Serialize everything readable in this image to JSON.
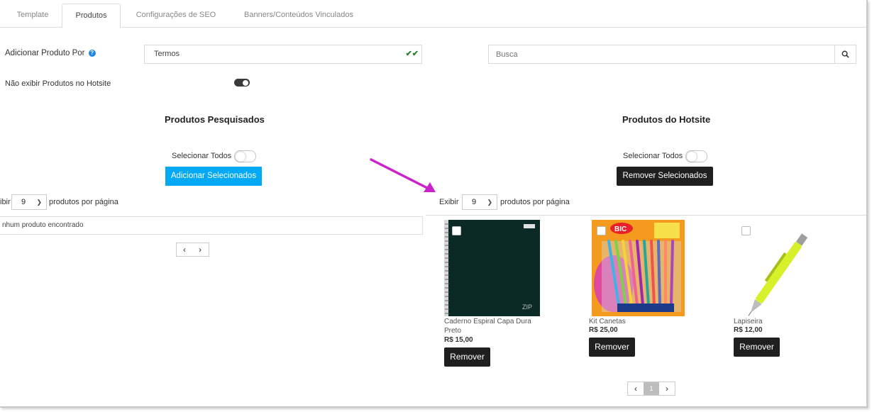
{
  "tabs": [
    {
      "label": "Template"
    },
    {
      "label": "Produtos"
    },
    {
      "label": "Configurações de SEO"
    },
    {
      "label": "Banners/Conteúdos Vinculados"
    }
  ],
  "form": {
    "add_by_label": "Adicionar Produto Por",
    "add_by_value": "Termos",
    "search_placeholder": "Busca",
    "hide_products_label": "Não exibir Produtos no Hotsite"
  },
  "left": {
    "title": "Produtos Pesquisados",
    "select_all": "Selecionar Todos",
    "action_button": "Adicionar Selecionados",
    "show_prefix": "ibir",
    "per_page_value": "9",
    "per_page_suffix": "produtos por página",
    "empty_message": "nhum produto encontrado"
  },
  "right": {
    "title": "Produtos do Hotsite",
    "select_all": "Selecionar Todos",
    "action_button": "Remover Selecionados",
    "show_prefix": "Exibir",
    "per_page_value": "9",
    "per_page_suffix": "produtos por página",
    "current_page": "1",
    "products": [
      {
        "name": "Caderno Espiral Capa Dura Preto",
        "price": "R$ 15,00",
        "remove": "Remover",
        "cover_text": "ZIP"
      },
      {
        "name": "Kit Canetas",
        "price": "R$ 25,00",
        "remove": "Remover",
        "cover_text": "BIC"
      },
      {
        "name": "Lapiseira",
        "price": "R$ 12,00",
        "remove": "Remover"
      }
    ]
  },
  "colors": {
    "primary_blue": "#03a9f4",
    "dark_button": "#1f1f1f",
    "arrow": "#cc22cc"
  }
}
